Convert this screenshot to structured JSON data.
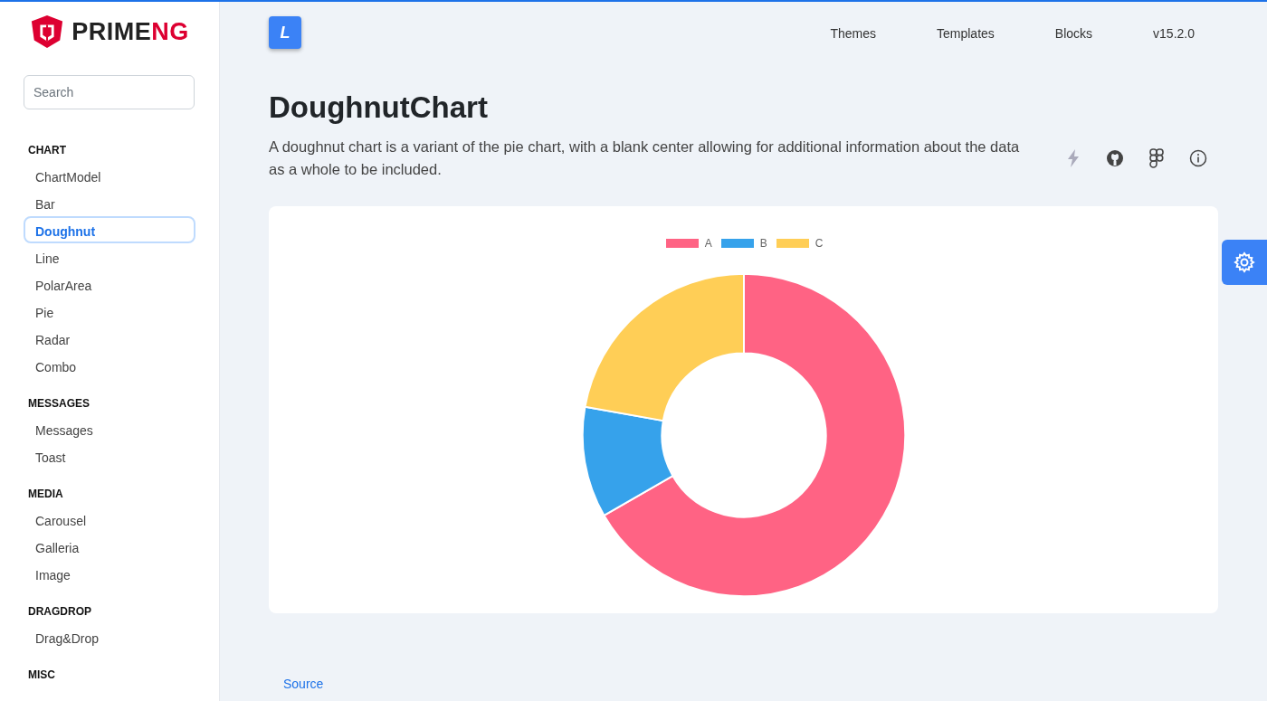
{
  "sidebar": {
    "logo": {
      "prefix": "PRIME",
      "suffix": "NG"
    },
    "search": {
      "placeholder": "Search"
    },
    "sections": [
      {
        "title": "CHART",
        "items": [
          {
            "label": "ChartModel",
            "selected": false
          },
          {
            "label": "Bar",
            "selected": false
          },
          {
            "label": "Doughnut",
            "selected": true
          },
          {
            "label": "Line",
            "selected": false
          },
          {
            "label": "PolarArea",
            "selected": false
          },
          {
            "label": "Pie",
            "selected": false
          },
          {
            "label": "Radar",
            "selected": false
          },
          {
            "label": "Combo",
            "selected": false
          }
        ]
      },
      {
        "title": "MESSAGES",
        "items": [
          {
            "label": "Messages",
            "selected": false
          },
          {
            "label": "Toast",
            "selected": false
          }
        ]
      },
      {
        "title": "MEDIA",
        "items": [
          {
            "label": "Carousel",
            "selected": false
          },
          {
            "label": "Galleria",
            "selected": false
          },
          {
            "label": "Image",
            "selected": false
          }
        ]
      },
      {
        "title": "DRAGDROP",
        "items": [
          {
            "label": "Drag&Drop",
            "selected": false
          }
        ]
      },
      {
        "title": "MISC"
      }
    ]
  },
  "topbar": {
    "badge": "L",
    "links": [
      "Themes",
      "Templates",
      "Blocks",
      "v15.2.0"
    ]
  },
  "page": {
    "title": "DoughnutChart",
    "description": "A doughnut chart is a variant of the pie chart, with a blank center allowing for additional information about the data as a whole to be included.",
    "chart_data": {
      "type": "donut",
      "categories": [
        "A",
        "B",
        "C"
      ],
      "series": [
        {
          "values": [
            66.7,
            11.1,
            22.2
          ]
        }
      ],
      "colors": [
        "#ff6384",
        "#36a2eb",
        "#ffce56"
      ]
    },
    "source_link": "Source"
  }
}
